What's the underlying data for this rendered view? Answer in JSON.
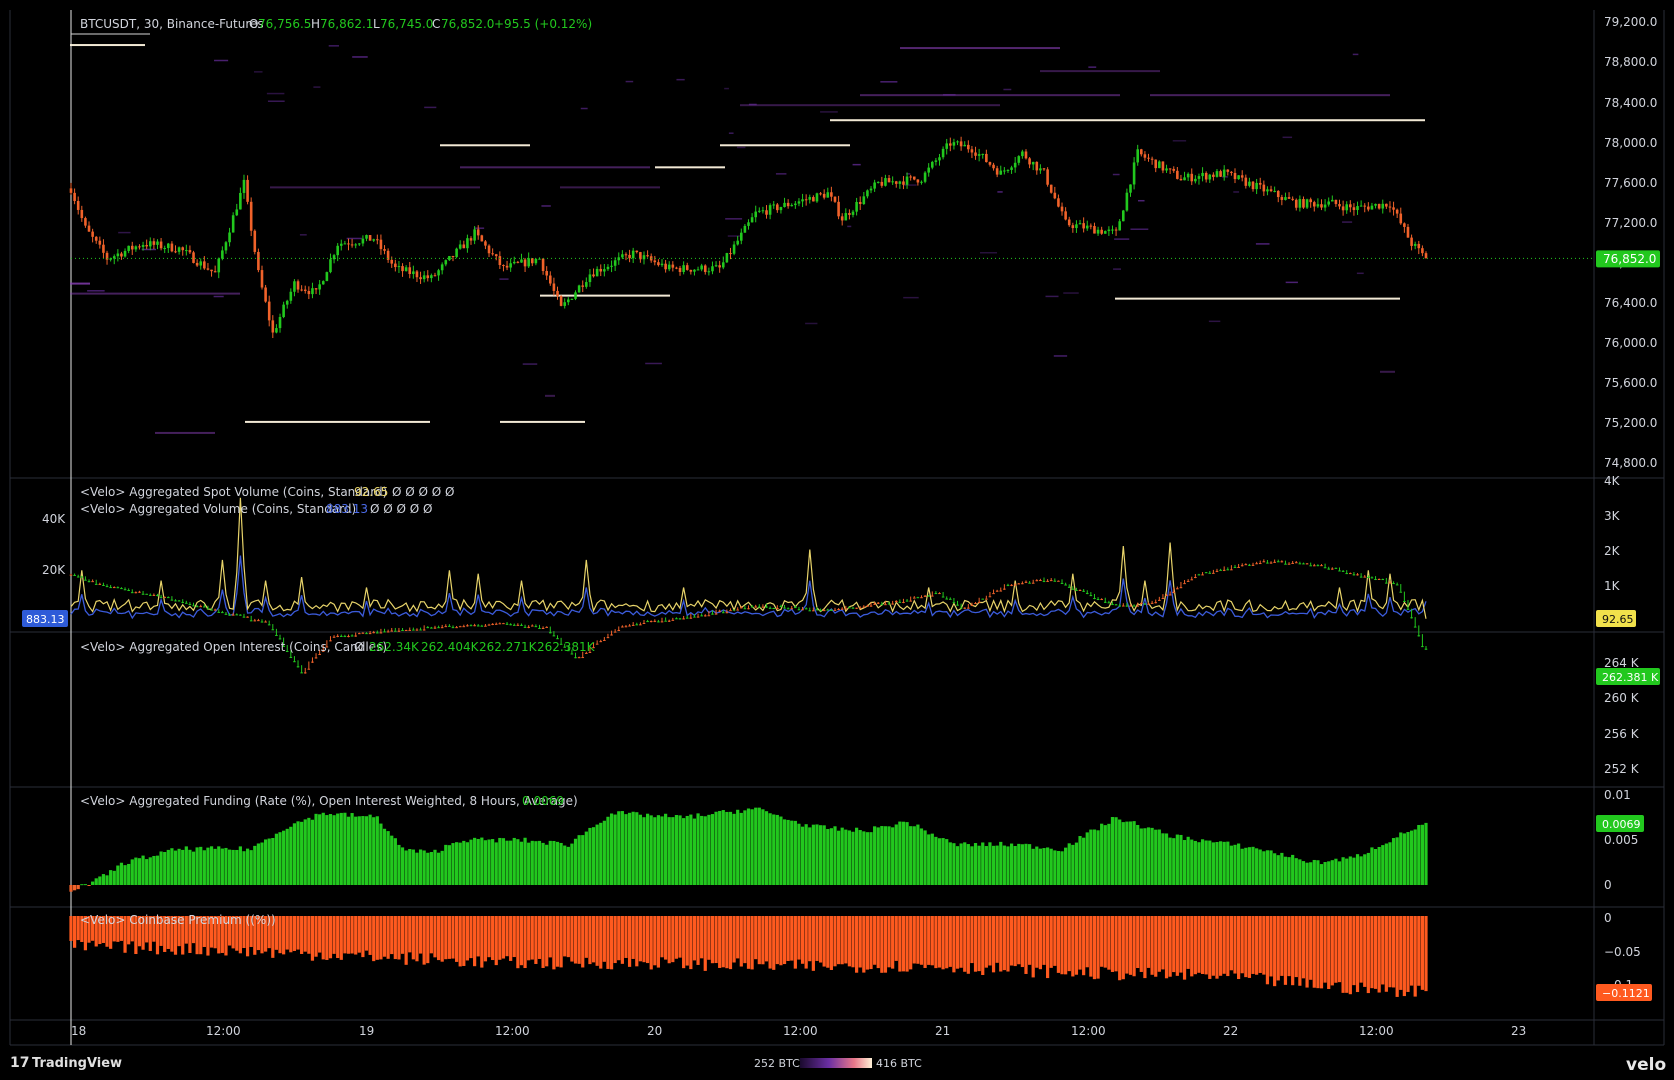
{
  "header": {
    "symbol": "BTCUSDT, 30, Binance-Futures",
    "o_label": "O",
    "o_value": "76,756.5",
    "h_label": "H",
    "h_value": "76,862.1",
    "l_label": "L",
    "l_value": "76,745.0",
    "c_label": "C",
    "c_value": "76,852.0",
    "change": "+95.5 (+0.12%)"
  },
  "colors": {
    "up": "#22c81e",
    "down": "#f0622a",
    "spot_line": "#e8d46a",
    "agg_line": "#3b5bdb",
    "premium": "#ff5a1f",
    "heat_low": "#5b2a86",
    "heat_high": "#fff3d0",
    "background": "#000000",
    "grid": "#1a1a1a"
  },
  "x_axis": {
    "labels": [
      "18",
      "12:00",
      "19",
      "12:00",
      "20",
      "12:00",
      "21",
      "12:00",
      "22",
      "12:00",
      "23"
    ]
  },
  "footer": {
    "brand": "TradingView",
    "logo_text": "velo",
    "heat_min": "252 BTC",
    "heat_max": "416 BTC"
  },
  "panes": {
    "price": {
      "y_ticks": [
        "79,200.0",
        "78,800.0",
        "78,400.0",
        "78,000.0",
        "77,600.0",
        "77,200.0",
        "76,800.0",
        "76,400.0",
        "76,000.0",
        "75,600.0",
        "75,200.0",
        "74,800.0"
      ],
      "last_price": "76,852.0"
    },
    "volume": {
      "label_spot": "<Velo> Aggregated Spot Volume (Coins, Standard)",
      "spot_value": "92.65",
      "spot_nulls": "Ø Ø Ø Ø Ø",
      "label_agg": "<Velo> Aggregated Volume (Coins, Standard)",
      "agg_value": "883.13",
      "agg_nulls": "Ø Ø Ø Ø Ø",
      "left_ticks": [
        "40K",
        "20K"
      ],
      "right_ticks": [
        "4K",
        "3K",
        "2K",
        "1K"
      ],
      "left_badge": "883.13",
      "right_badge": "92.65"
    },
    "oi": {
      "label": "<Velo> Aggregated Open Interest (Coins, Candles)",
      "null_mark": "Ø",
      "values": [
        "262.34K",
        "262.404K",
        "262.271K",
        "262.381K"
      ],
      "right_ticks": [
        "264 K",
        "260 K",
        "256 K",
        "252 K"
      ],
      "badge": "262.381 K"
    },
    "funding": {
      "label": "<Velo> Aggregated Funding (Rate (%), Open Interest Weighted, 8 Hours, Average)",
      "value": "0.0069",
      "right_ticks": [
        "0.01",
        "0.005",
        "0"
      ],
      "badge": "0.0069"
    },
    "premium": {
      "label": "<Velo> Coinbase Premium ((%))",
      "right_ticks": [
        "0",
        "−0.05",
        "−0.1"
      ],
      "badge": "−0.1121"
    }
  },
  "chart_data": [
    {
      "type": "candlestick",
      "title": "BTCUSDT, 30, Binance-Futures",
      "y_range": [
        74700,
        79300
      ],
      "last": 76852.0,
      "path_anchors": [
        [
          0,
          77550
        ],
        [
          4,
          77150
        ],
        [
          10,
          76850
        ],
        [
          20,
          77000
        ],
        [
          30,
          76950
        ],
        [
          40,
          76700
        ],
        [
          48,
          77600
        ],
        [
          52,
          76700
        ],
        [
          56,
          76100
        ],
        [
          62,
          76600
        ],
        [
          68,
          76500
        ],
        [
          74,
          77000
        ],
        [
          84,
          77050
        ],
        [
          90,
          76750
        ],
        [
          100,
          76650
        ],
        [
          112,
          77100
        ],
        [
          120,
          76750
        ],
        [
          130,
          76850
        ],
        [
          136,
          76350
        ],
        [
          144,
          76700
        ],
        [
          156,
          76900
        ],
        [
          166,
          76750
        ],
        [
          180,
          76750
        ],
        [
          190,
          77300
        ],
        [
          200,
          77400
        ],
        [
          210,
          77500
        ],
        [
          214,
          77250
        ],
        [
          224,
          77600
        ],
        [
          236,
          77650
        ],
        [
          244,
          78000
        ],
        [
          250,
          77950
        ],
        [
          258,
          77700
        ],
        [
          264,
          77900
        ],
        [
          270,
          77700
        ],
        [
          276,
          77200
        ],
        [
          290,
          77100
        ],
        [
          296,
          77900
        ],
        [
          308,
          77650
        ],
        [
          320,
          77700
        ],
        [
          330,
          77550
        ],
        [
          340,
          77400
        ],
        [
          350,
          77400
        ],
        [
          356,
          77350
        ],
        [
          366,
          77400
        ],
        [
          372,
          77000
        ],
        [
          376,
          76852
        ]
      ]
    },
    {
      "type": "line",
      "title": "<Velo> Aggregated Spot Volume (Coins, Standard)",
      "last": 92.65,
      "y_range": [
        0,
        4000
      ],
      "spikes": [
        [
          3,
          1500
        ],
        [
          25,
          1200
        ],
        [
          42,
          1800
        ],
        [
          47,
          3600
        ],
        [
          54,
          1200
        ],
        [
          64,
          1300
        ],
        [
          82,
          1000
        ],
        [
          105,
          1500
        ],
        [
          113,
          1400
        ],
        [
          125,
          1200
        ],
        [
          143,
          1800
        ],
        [
          170,
          1000
        ],
        [
          205,
          2100
        ],
        [
          238,
          1000
        ],
        [
          262,
          1200
        ],
        [
          278,
          1400
        ],
        [
          292,
          2200
        ],
        [
          298,
          1200
        ],
        [
          305,
          2300
        ],
        [
          352,
          1000
        ],
        [
          360,
          1500
        ],
        [
          366,
          1400
        ]
      ]
    },
    {
      "type": "line",
      "title": "<Velo> Aggregated Volume (Coins, Standard)",
      "last": 883.13,
      "y_range": [
        0,
        40000
      ]
    },
    {
      "type": "candlestick",
      "title": "<Velo> Aggregated Open Interest (Coins, Candles)",
      "last": 262381,
      "y_range": [
        251000,
        265000
      ],
      "path_anchors": [
        [
          0,
          254000
        ],
        [
          12,
          255500
        ],
        [
          25,
          256500
        ],
        [
          40,
          258000
        ],
        [
          55,
          259500
        ],
        [
          64,
          265000
        ],
        [
          72,
          261000
        ],
        [
          90,
          260200
        ],
        [
          120,
          259500
        ],
        [
          132,
          260000
        ],
        [
          140,
          263500
        ],
        [
          152,
          259800
        ],
        [
          175,
          258500
        ],
        [
          190,
          257500
        ],
        [
          210,
          258000
        ],
        [
          230,
          257000
        ],
        [
          240,
          256000
        ],
        [
          248,
          257800
        ],
        [
          260,
          255000
        ],
        [
          272,
          254500
        ],
        [
          290,
          257500
        ],
        [
          300,
          257200
        ],
        [
          312,
          254000
        ],
        [
          330,
          252500
        ],
        [
          345,
          252800
        ],
        [
          352,
          253500
        ],
        [
          362,
          254500
        ],
        [
          368,
          255000
        ],
        [
          376,
          263000
        ]
      ]
    },
    {
      "type": "bar",
      "title": "<Velo> Aggregated Funding (Rate (%), Open Interest Weighted, 8 Hours, Average)",
      "last": 0.0069,
      "y_range": [
        -0.001,
        0.0105
      ],
      "path_anchors": [
        [
          0,
          -0.0005
        ],
        [
          6,
          0.0002
        ],
        [
          15,
          0.0025
        ],
        [
          30,
          0.004
        ],
        [
          50,
          0.004
        ],
        [
          60,
          0.0065
        ],
        [
          70,
          0.008
        ],
        [
          85,
          0.0075
        ],
        [
          92,
          0.004
        ],
        [
          100,
          0.0035
        ],
        [
          108,
          0.005
        ],
        [
          125,
          0.005
        ],
        [
          138,
          0.0045
        ],
        [
          150,
          0.008
        ],
        [
          170,
          0.0075
        ],
        [
          190,
          0.0085
        ],
        [
          205,
          0.0065
        ],
        [
          220,
          0.006
        ],
        [
          232,
          0.007
        ],
        [
          245,
          0.0045
        ],
        [
          262,
          0.0045
        ],
        [
          275,
          0.004
        ],
        [
          290,
          0.0075
        ],
        [
          305,
          0.0055
        ],
        [
          330,
          0.004
        ],
        [
          345,
          0.0025
        ],
        [
          356,
          0.003
        ],
        [
          366,
          0.005
        ],
        [
          376,
          0.0069
        ]
      ]
    },
    {
      "type": "bar",
      "title": "<Velo> Coinbase Premium ((%))",
      "last": -0.1121,
      "y_range": [
        -0.13,
        0.005
      ],
      "path_anchors": [
        [
          0,
          -0.045
        ],
        [
          40,
          -0.05
        ],
        [
          80,
          -0.06
        ],
        [
          120,
          -0.07
        ],
        [
          160,
          -0.07
        ],
        [
          200,
          -0.075
        ],
        [
          240,
          -0.075
        ],
        [
          280,
          -0.085
        ],
        [
          320,
          -0.09
        ],
        [
          360,
          -0.11
        ],
        [
          376,
          -0.1121
        ]
      ]
    }
  ]
}
